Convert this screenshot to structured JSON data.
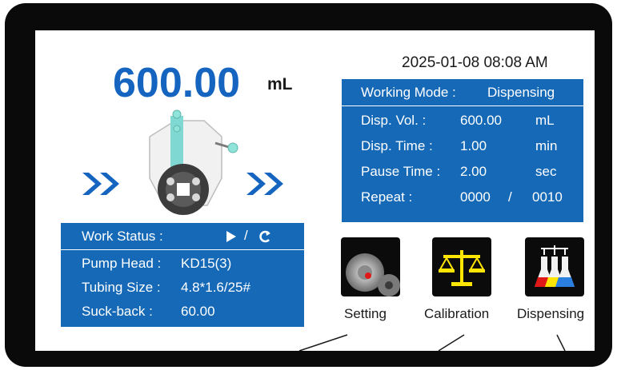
{
  "volume": {
    "value": "600.00",
    "unit": "mL"
  },
  "datetime": "2025-01-08 08:08 AM",
  "working_mode": {
    "label": "Working Mode :",
    "value": "Dispensing",
    "rows": [
      {
        "label": "Disp. Vol. :",
        "value": "600.00",
        "unit": "mL"
      },
      {
        "label": "Disp. Time :",
        "value": "1.00",
        "unit": "min"
      },
      {
        "label": "Pause Time :",
        "value": "2.00",
        "unit": "sec"
      }
    ],
    "repeat": {
      "label": "Repeat :",
      "current": "0000",
      "separator": "/",
      "total": "0010"
    }
  },
  "work_status": {
    "label": "Work Status :",
    "separator": "/",
    "rows": [
      {
        "label": "Pump Head :",
        "value": "KD15(3)"
      },
      {
        "label": "Tubing Size :",
        "value": "4.8*1.6/25#"
      },
      {
        "label": "Suck-back :",
        "value": "60.00"
      }
    ]
  },
  "menu": [
    {
      "label": "Setting",
      "icon": "gear-icon"
    },
    {
      "label": "Calibration",
      "icon": "balance-scale-icon"
    },
    {
      "label": "Dispensing",
      "icon": "flasks-icon"
    }
  ],
  "colors": {
    "accent": "#1569b7",
    "volume_text": "#1565c0",
    "pump_tube": "#7fd8d2",
    "scale": "#ffe600"
  }
}
